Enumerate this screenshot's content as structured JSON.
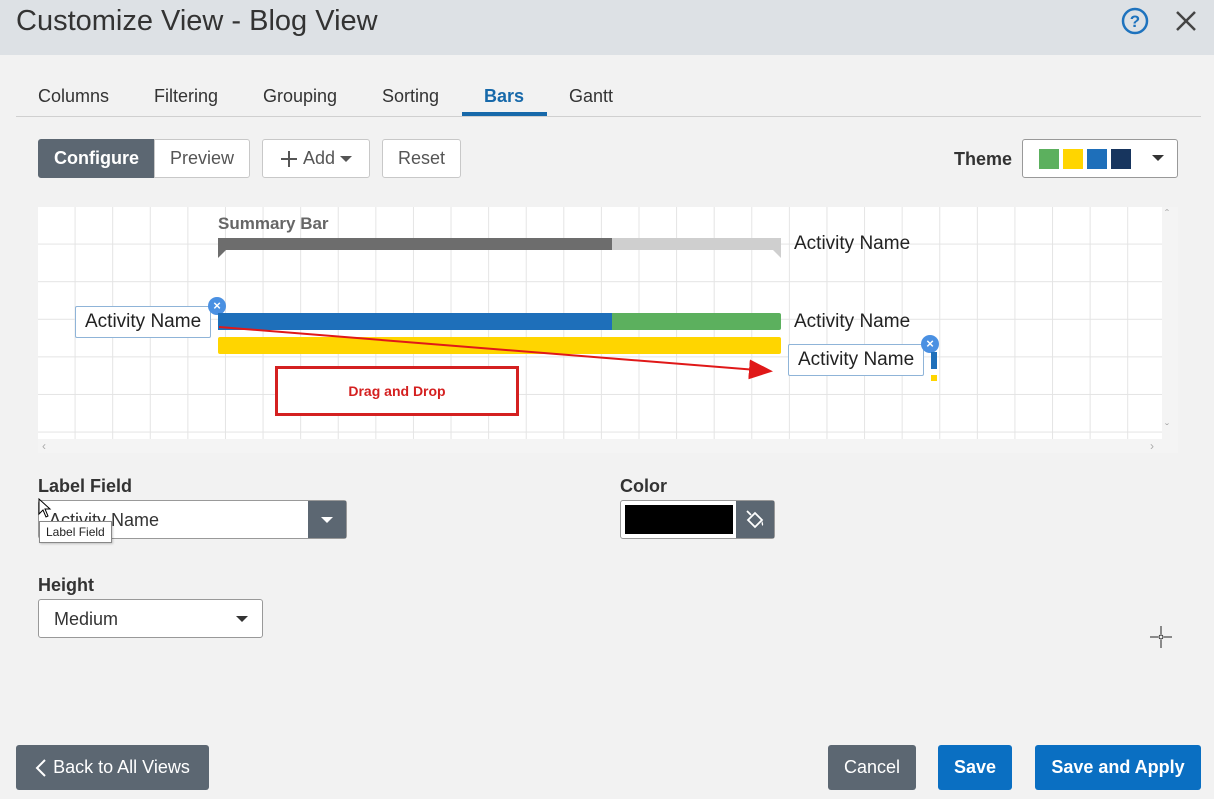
{
  "header": {
    "title": "Customize View - Blog View",
    "help_icon": "help-circle-icon",
    "close_icon": "close-icon"
  },
  "tabs": [
    {
      "label": "Columns",
      "active": false
    },
    {
      "label": "Filtering",
      "active": false
    },
    {
      "label": "Grouping",
      "active": false
    },
    {
      "label": "Sorting",
      "active": false
    },
    {
      "label": "Bars",
      "active": true
    },
    {
      "label": "Gantt",
      "active": false
    }
  ],
  "toolbar": {
    "configure_label": "Configure",
    "preview_label": "Preview",
    "add_label": "Add",
    "reset_label": "Reset",
    "theme_label": "Theme",
    "theme_colors": [
      "#5cb05e",
      "#ffd500",
      "#1e6fba",
      "#17355e"
    ]
  },
  "canvas": {
    "summary_label": "Summary Bar",
    "summary_right_label": "Activity Name",
    "left_chip_label": "Activity Name",
    "bar_right_label": "Activity Name",
    "dragged_chip_label": "Activity Name",
    "drag_drop_label": "Drag and Drop",
    "summary_progress": 0.7,
    "colors": {
      "blue": "#1e6fba",
      "green": "#5cb05e",
      "yellow": "#ffd500",
      "summary_dark": "#6d6d6d",
      "summary_light": "#cfcfcf",
      "annotation": "#d42020"
    }
  },
  "form": {
    "label_field_label": "Label Field",
    "label_field_value": "Activity Name",
    "tooltip_text": "Label Field",
    "color_label": "Color",
    "color_value": "#000000",
    "height_label": "Height",
    "height_value": "Medium"
  },
  "footer": {
    "back_label": "Back to All Views",
    "cancel_label": "Cancel",
    "save_label": "Save",
    "save_apply_label": "Save and Apply"
  }
}
